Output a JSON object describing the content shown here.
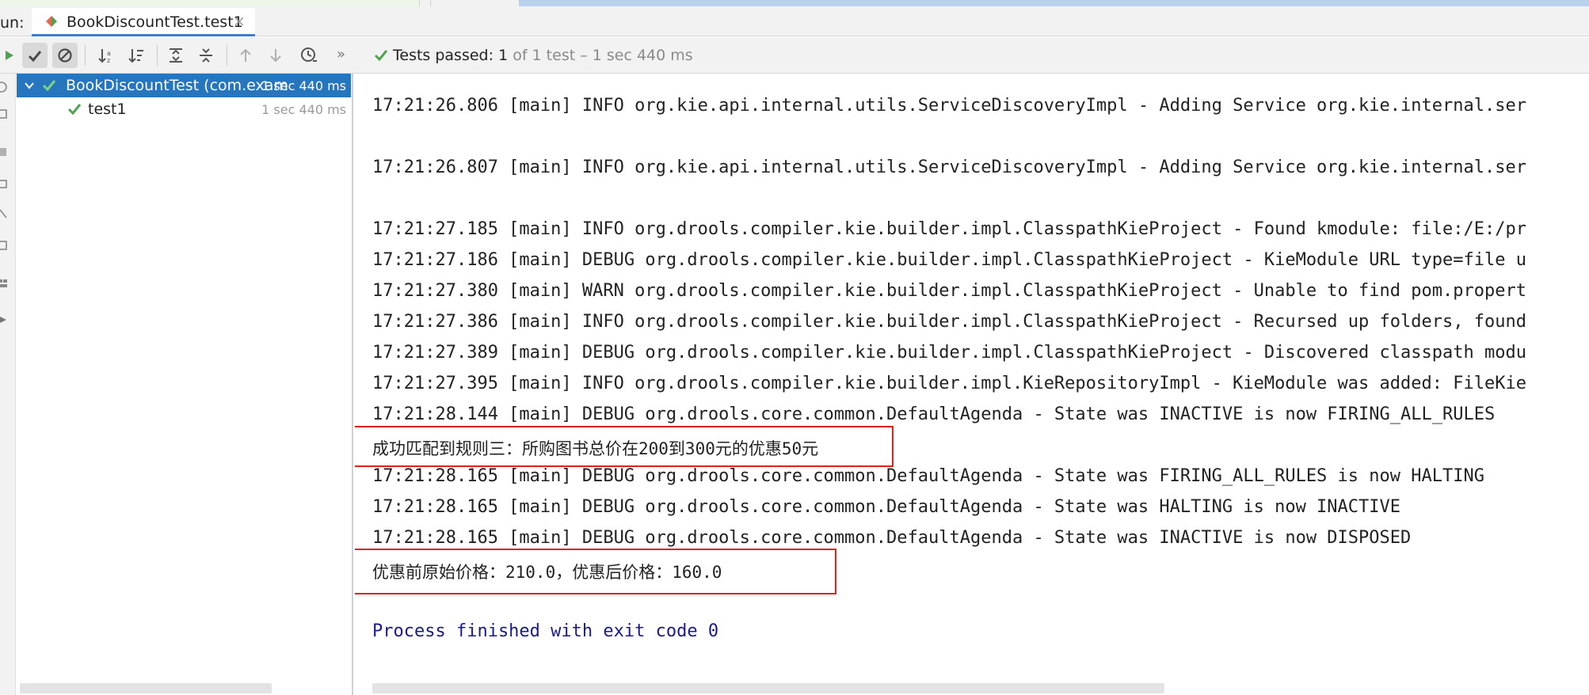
{
  "window": {
    "run_label": "un:",
    "tab": {
      "title": "BookDiscountTest.test1",
      "close": "×"
    }
  },
  "toolbar": {
    "chevrons": "»",
    "status_prefix": "Tests passed:",
    "status_count": "1",
    "status_rest": "of 1 test – 1 sec 440 ms"
  },
  "tree": {
    "items": [
      {
        "name": "BookDiscountTest (com.examp",
        "duration": "1 sec 440 ms",
        "selected": true
      },
      {
        "name": "test1",
        "duration": "1 sec 440 ms",
        "selected": false
      }
    ]
  },
  "console": {
    "lines": [
      "17:21:26.806 [main] INFO org.kie.api.internal.utils.ServiceDiscoveryImpl - Adding Service org.kie.internal.ser",
      "17:21:26.807 [main] INFO org.kie.api.internal.utils.ServiceDiscoveryImpl - Adding Service org.kie.internal.ser",
      "17:21:27.185 [main] INFO org.drools.compiler.kie.builder.impl.ClasspathKieProject - Found kmodule: file:/E:/pr",
      "17:21:27.186 [main] DEBUG org.drools.compiler.kie.builder.impl.ClasspathKieProject - KieModule URL type=file u",
      "17:21:27.380 [main] WARN org.drools.compiler.kie.builder.impl.ClasspathKieProject - Unable to find pom.propert",
      "17:21:27.386 [main] INFO org.drools.compiler.kie.builder.impl.ClasspathKieProject - Recursed up folders, found",
      "17:21:27.389 [main] DEBUG org.drools.compiler.kie.builder.impl.ClasspathKieProject - Discovered classpath modu",
      "17:21:27.395 [main] INFO org.drools.compiler.kie.builder.impl.KieRepositoryImpl - KieModule was added: FileKie",
      "17:21:28.144 [main] DEBUG org.drools.core.common.DefaultAgenda - State was INACTIVE is now FIRING_ALL_RULES",
      "成功匹配到规则三：所购图书总价在200到300元的优惠50元",
      "17:21:28.165 [main] DEBUG org.drools.core.common.DefaultAgenda - State was FIRING_ALL_RULES is now HALTING",
      "17:21:28.165 [main] DEBUG org.drools.core.common.DefaultAgenda - State was HALTING is now INACTIVE",
      "17:21:28.165 [main] DEBUG org.drools.core.common.DefaultAgenda - State was INACTIVE is now DISPOSED",
      "优惠前原始价格：210.0，优惠后价格：160.0",
      "Process finished with exit code 0"
    ]
  },
  "colors": {
    "accent": "#2675bf",
    "pass_green": "#4ea44e",
    "highlight_red": "#e02020",
    "exit_text": "#1a1a8c"
  }
}
